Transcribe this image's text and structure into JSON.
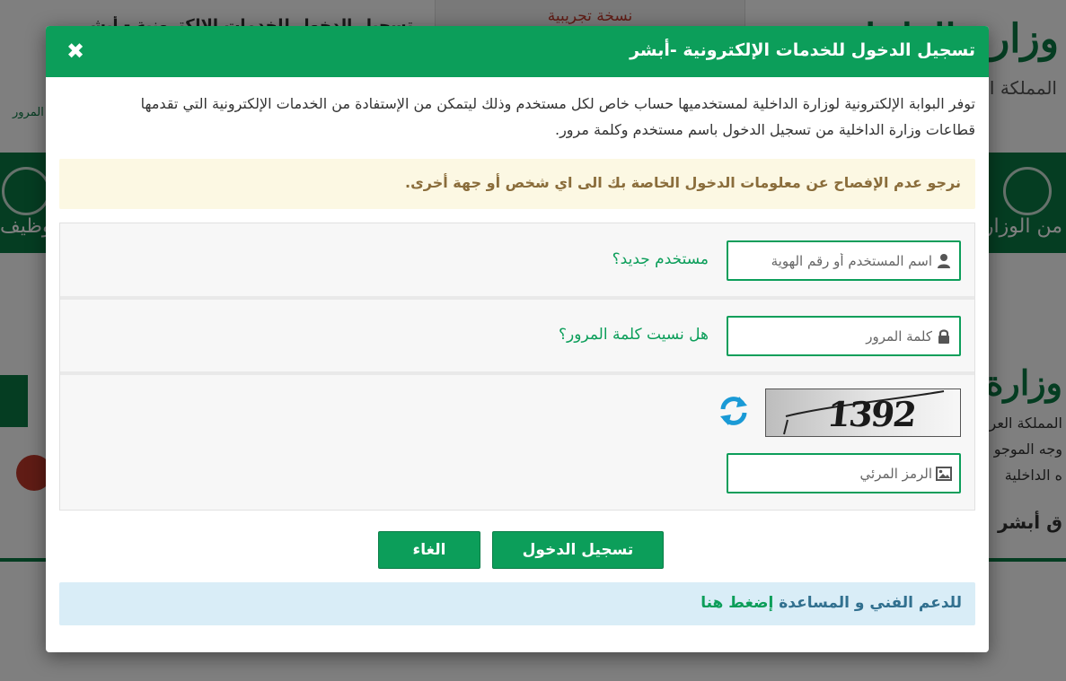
{
  "background": {
    "top_title": "تسجيل الدخول للخدمات الإلكترونية - أبشر",
    "trial_banner": "نسخة تجريبية",
    "ministry_name": "وزارة الداخلية",
    "kingdom_name": "المملكة العربية السعودية",
    "left_small_link": "المرور",
    "nav_left": "وظيف",
    "nav_right": "من الوزارة",
    "ministry_name_2": "وزارة الداخلية",
    "line_1": "المملكة العربية",
    "line_2": "وجه الموجو",
    "line_3": "ه الداخلية",
    "line_4": "ق أبشر"
  },
  "modal": {
    "title": "تسجيل الدخول للخدمات الإلكترونية -أبشر",
    "close_glyph": "✖",
    "intro_text": "توفر البوابة الإلكترونية لوزارة الداخلية لمستخدميها حساب خاص لكل مستخدم وذلك ليتمكن من الإستفادة من الخدمات الإلكترونية التي تقدمها قطاعات وزارة الداخلية من تسجيل الدخول باسم مستخدم وكلمة مرور.",
    "warning_text": "نرجو عدم الإفصاح عن معلومات الدخول الخاصة بك الى اي شخص أو جهة أخرى.",
    "username": {
      "placeholder": "اسم المستخدم أو رقم الهوية",
      "value": "",
      "icon": "user-icon"
    },
    "new_user_link": "مستخدم جديد؟",
    "password": {
      "placeholder": "كلمة المرور",
      "value": "",
      "icon": "lock-icon"
    },
    "forgot_password_link": "هل نسيت كلمة المرور؟",
    "captcha": {
      "image_text": "1392",
      "refresh_icon": "refresh-icon",
      "input_placeholder": "الرمز المرئي",
      "input_value": "",
      "icon": "image-icon"
    },
    "login_button": "تسجيل الدخول",
    "cancel_button": "الغاء",
    "support_text": "للدعم الفني و المساعدة",
    "support_link": "إضغط هنا"
  },
  "colors": {
    "brand_green": "#0c9e5a",
    "warning_bg": "#fcf8e3",
    "warning_text": "#8a6d3b",
    "info_bg": "#d9edf7",
    "info_text": "#31708f"
  }
}
